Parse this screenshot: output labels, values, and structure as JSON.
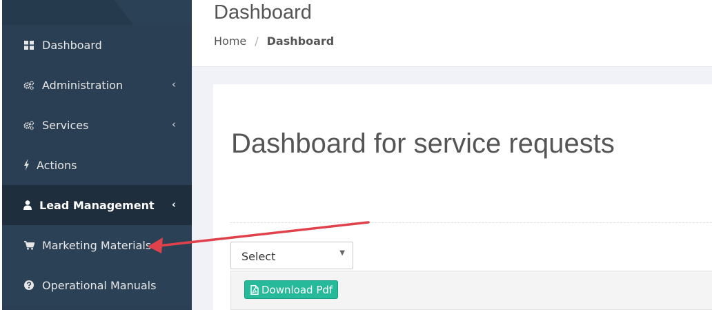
{
  "sidebar": {
    "items": [
      {
        "label": "Dashboard",
        "icon": "dashboard-icon"
      },
      {
        "label": "Administration",
        "icon": "cogs-icon",
        "chevron": "‹"
      },
      {
        "label": "Services",
        "icon": "cogs-icon",
        "chevron": "‹"
      },
      {
        "label": "Actions",
        "icon": "bolt-icon"
      },
      {
        "label": "Lead Management",
        "icon": "user-icon",
        "chevron": "‹",
        "state": "active"
      },
      {
        "label": "Marketing Materials",
        "icon": "cart-icon"
      },
      {
        "label": "Operational Manuals",
        "icon": "question-circle-icon"
      }
    ]
  },
  "header": {
    "title": "Dashboard",
    "breadcrumb": {
      "home": "Home",
      "separator": "/",
      "current": "Dashboard"
    }
  },
  "main": {
    "card_title": "Dashboard for service requests",
    "select": {
      "value": "Select",
      "caret": "▼"
    },
    "download_button": {
      "label": "Download Pdf",
      "icon": "file-pdf-icon"
    }
  },
  "colors": {
    "sidebar_bg": "#2a3f54",
    "sidebar_active_bg": "#1f2e3c",
    "accent_green": "#26b99a",
    "annotation_arrow": "#e0424b"
  }
}
